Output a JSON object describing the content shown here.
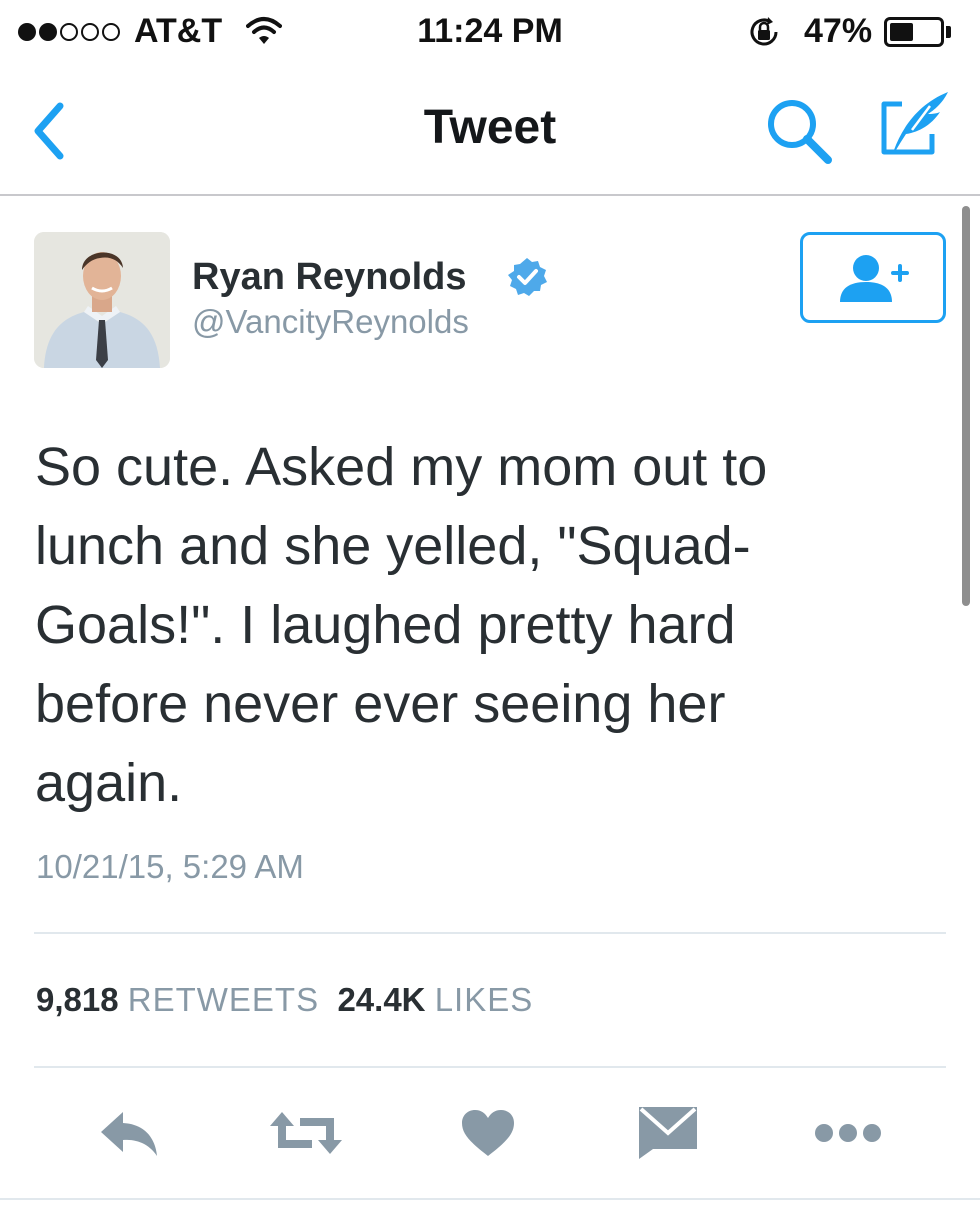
{
  "status_bar": {
    "signal_dots": [
      true,
      true,
      false,
      false,
      false
    ],
    "carrier": "AT&T",
    "time": "11:24 PM",
    "battery_percent": "47%",
    "battery_level": 0.47,
    "icons": [
      "wifi-icon",
      "rotation-lock-icon",
      "battery-icon"
    ]
  },
  "nav": {
    "title": "Tweet",
    "icons": [
      "back-chevron-icon",
      "search-icon",
      "compose-icon"
    ]
  },
  "author": {
    "name": "Ryan Reynolds",
    "handle": "@VancityReynolds",
    "verified": true,
    "follow_icon": "add-user-icon"
  },
  "tweet": {
    "text_lines": [
      "So cute. Asked my mom out to",
      "lunch and she yelled, \"Squad-",
      "Goals!\". I laughed pretty hard",
      "before never ever seeing her",
      "again."
    ],
    "timestamp": "10/21/15, 5:29 AM"
  },
  "stats": {
    "retweets_count": "9,818",
    "retweets_label": "RETWEETS",
    "likes_count": "24.4K",
    "likes_label": "LIKES"
  },
  "actions": [
    "reply-icon",
    "retweet-icon",
    "like-icon",
    "direct-message-icon",
    "more-icon"
  ],
  "colors": {
    "accent": "#1da1f2",
    "text": "#292f33",
    "secondary": "#8899a6",
    "action_gray": "#8899a6"
  }
}
